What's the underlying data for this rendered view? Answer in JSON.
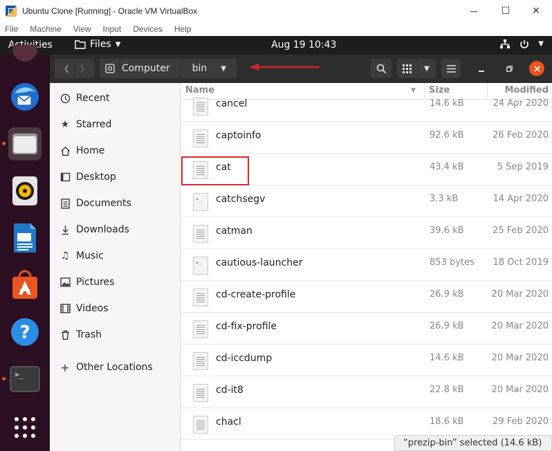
{
  "vbox": {
    "title": "Ubuntu Clone [Running] - Oracle VM VirtualBox",
    "menu": [
      "File",
      "Machine",
      "View",
      "Input",
      "Devices",
      "Help"
    ],
    "controls": {
      "minimize": "─",
      "maximize": "☐",
      "close": "✕"
    }
  },
  "topbar": {
    "activities": "Activities",
    "app_menu": "Files",
    "clock": "Aug 19  10:43"
  },
  "headerbar": {
    "back": "〈",
    "forward": "〉",
    "path": [
      "Computer",
      "bin"
    ]
  },
  "sidebar": {
    "items": [
      {
        "label": "Recent",
        "icon": "clock-icon"
      },
      {
        "label": "Starred",
        "icon": "star-icon"
      },
      {
        "label": "Home",
        "icon": "home-icon"
      },
      {
        "label": "Desktop",
        "icon": "desktop-icon"
      },
      {
        "label": "Documents",
        "icon": "document-icon"
      },
      {
        "label": "Downloads",
        "icon": "download-icon"
      },
      {
        "label": "Music",
        "icon": "music-icon"
      },
      {
        "label": "Pictures",
        "icon": "picture-icon"
      },
      {
        "label": "Videos",
        "icon": "video-icon"
      },
      {
        "label": "Trash",
        "icon": "trash-icon"
      }
    ],
    "other_locations": "Other Locations"
  },
  "columns": {
    "name": "Name",
    "size": "Size",
    "modified": "Modified"
  },
  "files": [
    {
      "name": "cancel",
      "size": "14.6 kB",
      "modified": "24 Apr 2020",
      "type": "text"
    },
    {
      "name": "captoinfo",
      "size": "92.6 kB",
      "modified": "26 Feb 2020",
      "type": "text"
    },
    {
      "name": "cat",
      "size": "43.4 kB",
      "modified": "5 Sep 2019",
      "type": "text"
    },
    {
      "name": "catchsegv",
      "size": "3.3 kB",
      "modified": "14 Apr 2020",
      "type": "exec"
    },
    {
      "name": "catman",
      "size": "39.6 kB",
      "modified": "25 Feb 2020",
      "type": "text"
    },
    {
      "name": "cautious-launcher",
      "size": "853 bytes",
      "modified": "18 Oct 2019",
      "type": "exec"
    },
    {
      "name": "cd-create-profile",
      "size": "26.9 kB",
      "modified": "20 Mar 2020",
      "type": "text"
    },
    {
      "name": "cd-fix-profile",
      "size": "26.9 kB",
      "modified": "20 Mar 2020",
      "type": "text"
    },
    {
      "name": "cd-iccdump",
      "size": "14.6 kB",
      "modified": "20 Mar 2020",
      "type": "text"
    },
    {
      "name": "cd-it8",
      "size": "22.8 kB",
      "modified": "20 Mar 2020",
      "type": "text"
    },
    {
      "name": "chacl",
      "size": "18.6 kB",
      "modified": "29 Feb 2020",
      "type": "text"
    }
  ],
  "status": "“prezip-bin” selected  (14.6 kB)",
  "colors": {
    "accent": "#e95420",
    "annotation_red": "#d6262b",
    "dock_bg": "#2c0f22",
    "headerbar_bg": "#2d2d2d"
  }
}
